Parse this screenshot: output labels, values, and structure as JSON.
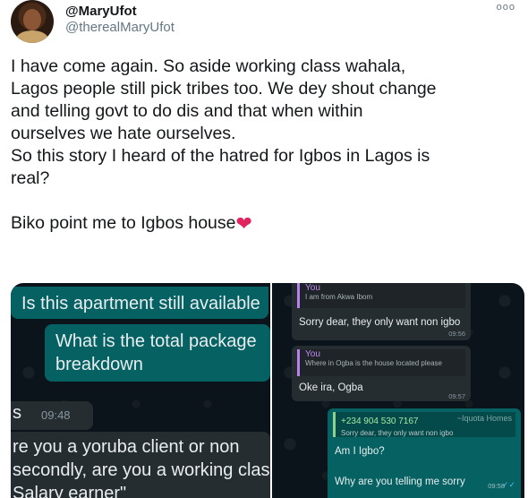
{
  "header": {
    "display_name": "@MaryUfot",
    "handle": "@therealMaryUfot",
    "more_label": "ooo"
  },
  "tweet": {
    "paragraph1": "I have come again. So aside working class wahala,\nLagos people still pick tribes too. We dey shout change\nand telling govt to do dis and that when within\nourselves we hate ourselves.\nSo this story I heard of the hatred for Igbos in Lagos is\nreal?",
    "paragraph2": "Biko point me to Igbos house",
    "emoji": "❤"
  },
  "left_image": {
    "msg1": "Is this apartment still available",
    "msg2": "What is the total package\nbreakdown",
    "msg3_text": "s",
    "msg3_time": "09:48",
    "msg4": "re you a yoruba client or non\nsecondly, are you a working clas\nSalary earner\""
  },
  "right_image": {
    "msg1_quote_name": "You",
    "msg1_quote_text": "I am from Akwa Ibom",
    "msg1_text": "Sorry dear, they only want non igbo",
    "msg1_time": "09:56",
    "msg2_quote_name": "You",
    "msg2_quote_text": "Where in Ogba is the house located please",
    "msg2_text": "Oke ira, Ogba",
    "msg2_time": "09:57",
    "msg3_quote_phone": "+234 904 530 7167",
    "msg3_quote_name": "~Iquota Homes",
    "msg3_quote_text": "Sorry dear, they only want non igbo",
    "msg3_line1": "Am I Igbo?",
    "msg3_line2": "Why are you telling me sorry",
    "msg3_time": "09:58",
    "msg3_ticks": "✓✓"
  },
  "colors": {
    "outgoing_bubble": "#056162",
    "incoming_bubble": "#262d31",
    "chat_background": "#0b141a",
    "heart": "#e0245e"
  }
}
